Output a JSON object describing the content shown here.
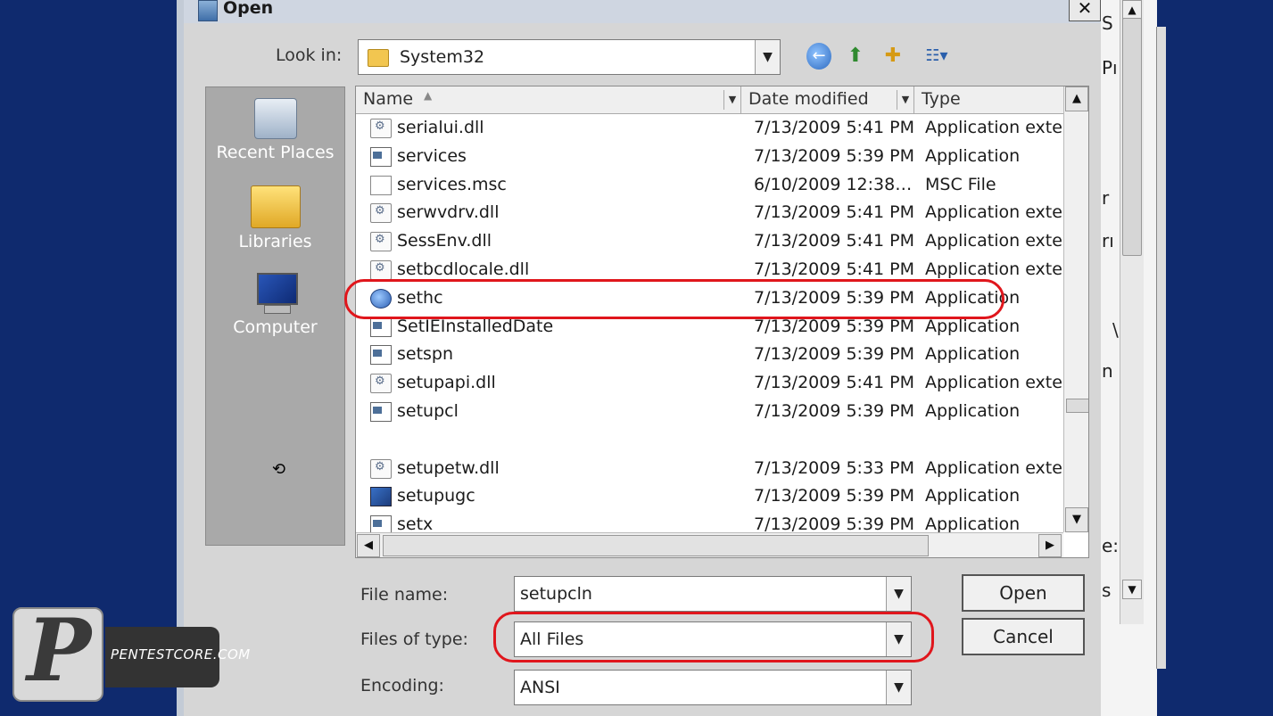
{
  "dialog": {
    "title": "Open",
    "close_glyph": "✕",
    "look_in": {
      "label": "Look in:",
      "value": "System32"
    },
    "toolbar": {
      "back_icon": "←",
      "up_icon": "⬆",
      "new_folder_icon": "✚",
      "view_icon": "☷▾"
    },
    "places": [
      {
        "label": "Recent Places",
        "icon": "recent-places-icon"
      },
      {
        "label": "Libraries",
        "icon": "libraries-icon"
      },
      {
        "label": "Computer",
        "icon": "computer-icon"
      }
    ],
    "columns": {
      "name": "Name",
      "date": "Date modified",
      "type": "Type"
    },
    "files": [
      {
        "name": "serialui.dll",
        "date": "7/13/2009 5:41 PM",
        "type": "Application exte…",
        "icon": "dll"
      },
      {
        "name": "services",
        "date": "7/13/2009 5:39 PM",
        "type": "Application",
        "icon": "app"
      },
      {
        "name": "services.msc",
        "date": "6/10/2009 12:38…",
        "type": "MSC File",
        "icon": "doc"
      },
      {
        "name": "serwvdrv.dll",
        "date": "7/13/2009 5:41 PM",
        "type": "Application exte…",
        "icon": "dll"
      },
      {
        "name": "SessEnv.dll",
        "date": "7/13/2009 5:41 PM",
        "type": "Application exte…",
        "icon": "dll"
      },
      {
        "name": "setbcdlocale.dll",
        "date": "7/13/2009 5:41 PM",
        "type": "Application exte…",
        "icon": "dll"
      },
      {
        "name": "sethc",
        "date": "7/13/2009 5:39 PM",
        "type": "Application",
        "icon": "globe"
      },
      {
        "name": "SetIEInstalledDate",
        "date": "7/13/2009 5:39 PM",
        "type": "Application",
        "icon": "app"
      },
      {
        "name": "setspn",
        "date": "7/13/2009 5:39 PM",
        "type": "Application",
        "icon": "app"
      },
      {
        "name": "setupapi.dll",
        "date": "7/13/2009 5:41 PM",
        "type": "Application exte…",
        "icon": "dll"
      },
      {
        "name": "setupcl",
        "date": "7/13/2009 5:39 PM",
        "type": "Application",
        "icon": "app"
      },
      {
        "name": "",
        "date": "",
        "type": "",
        "icon": ""
      },
      {
        "name": "setupetw.dll",
        "date": "7/13/2009 5:33 PM",
        "type": "Application exte…",
        "icon": "dll"
      },
      {
        "name": "setupugc",
        "date": "7/13/2009 5:39 PM",
        "type": "Application",
        "icon": "pc"
      },
      {
        "name": "setx",
        "date": "7/13/2009 5:39 PM",
        "type": "Application",
        "icon": "app"
      }
    ],
    "file_name": {
      "label": "File name:",
      "value": "setupcln"
    },
    "files_of_type": {
      "label": "Files of type:",
      "value": "All Files"
    },
    "encoding": {
      "label": "Encoding:",
      "value": "ANSI"
    },
    "open_label": "Open",
    "cancel_label": "Cancel"
  },
  "background_window": {
    "fragments": [
      "S",
      "Pı",
      "r",
      "rı",
      "\\",
      "n",
      "e:",
      "s"
    ]
  },
  "watermark": {
    "letter": "P",
    "text": "PENTESTCORE.COM"
  },
  "colors": {
    "desktop": "#0f2a6e",
    "highlight": "#e0161c"
  }
}
